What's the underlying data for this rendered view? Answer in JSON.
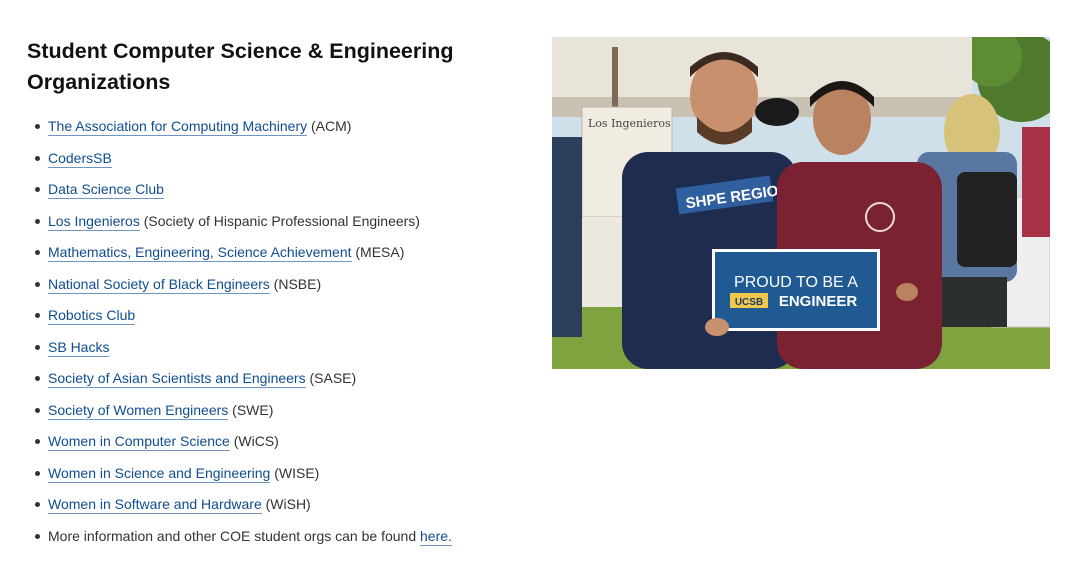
{
  "section": {
    "title": "Student Computer Science & Engineering Organizations"
  },
  "orgs": [
    {
      "link": "The Association for Computing Machinery",
      "suffix": " (ACM)"
    },
    {
      "link": "CodersSB",
      "suffix": ""
    },
    {
      "link": "Data Science Club",
      "suffix": ""
    },
    {
      "link": "Los Ingenieros",
      "suffix": " (Society of Hispanic Professional Engineers)"
    },
    {
      "link": "Mathematics, Engineering, Science Achievement",
      "suffix": " (MESA)"
    },
    {
      "link": "National Society of Black Engineers",
      "suffix": " (NSBE)"
    },
    {
      "link": "Robotics Club",
      "suffix": ""
    },
    {
      "link": "SB Hacks",
      "suffix": ""
    },
    {
      "link": "Society of Asian Scientists and Engineers",
      "suffix": " (SASE)"
    },
    {
      "link": "Society of Women Engineers",
      "suffix": " (SWE)"
    },
    {
      "link": "Women in Computer Science",
      "suffix": " (WiCS)"
    },
    {
      "link": "Women in Science and Engineering",
      "suffix": " (WISE)"
    },
    {
      "link": "Women in Software and Hardware",
      "suffix": " (WiSH)"
    }
  ],
  "more_info": {
    "text": "More information and other COE student orgs can be found ",
    "link": "here."
  },
  "photo": {
    "shirt_text": "SHPE REGION",
    "tent_sign": "Los Ingenieros",
    "sign_line1": "PROUD TO BE A",
    "sign_badge": "UCSB",
    "sign_line2": "ENGINEER"
  },
  "colors": {
    "link": "#0f4d92",
    "sign_blue": "#1f5a93",
    "badge_gold": "#f2c84b",
    "maroon": "#7a2232",
    "navy": "#1d2c4f"
  }
}
